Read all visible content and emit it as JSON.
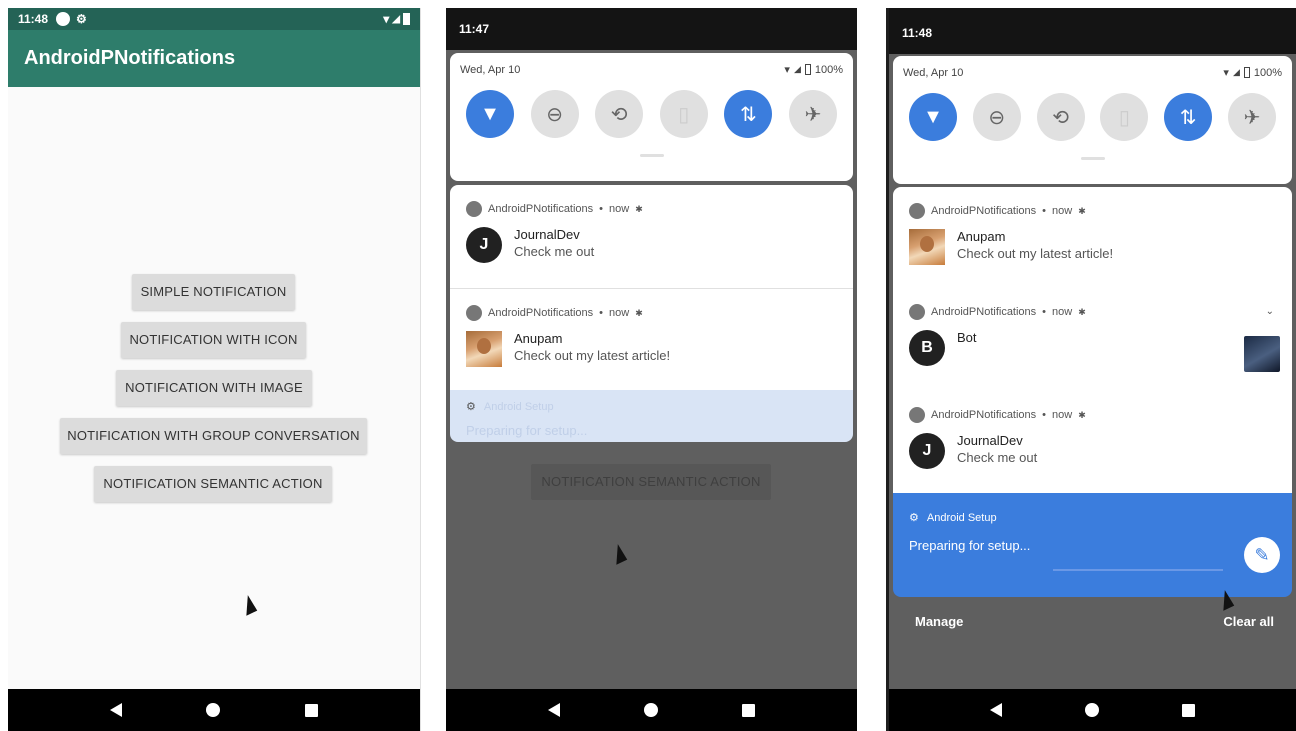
{
  "screen1": {
    "status": {
      "time": "11:48",
      "icons": [
        "circle-icon",
        "gear-icon"
      ],
      "right_icons": [
        "wifi-icon",
        "signal-icon",
        "battery-icon"
      ]
    },
    "app_title": "AndroidPNotifications",
    "buttons": [
      "SIMPLE NOTIFICATION",
      "NOTIFICATION WITH ICON",
      "NOTIFICATION WITH IMAGE",
      "NOTIFICATION WITH GROUP CONVERSATION",
      "NOTIFICATION SEMANTIC ACTION"
    ]
  },
  "screen2": {
    "time": "11:47",
    "date": "Wed, Apr 10",
    "battery": "100%",
    "tiles": [
      "wifi-icon",
      "do-not-disturb-icon",
      "auto-rotate-icon",
      "battery-saver-icon",
      "mobile-data-icon",
      "airplane-icon"
    ],
    "notifications": [
      {
        "app": "AndroidPNotifications",
        "when": "now",
        "title": "JournalDev",
        "message": "Check me out",
        "avatar": "J"
      },
      {
        "app": "AndroidPNotifications",
        "when": "now",
        "title": "Anupam",
        "message": "Check out my latest article!"
      }
    ],
    "setup_app": "Android Setup",
    "setup_message": "Preparing for setup...",
    "background_button": "NOTIFICATION SEMANTIC ACTION"
  },
  "screen3": {
    "time": "11:48",
    "date": "Wed, Apr 10",
    "battery": "100%",
    "notifications": [
      {
        "app": "AndroidPNotifications",
        "when": "now",
        "title": "Anupam",
        "message": "Check out my latest article!"
      },
      {
        "app": "AndroidPNotifications",
        "when": "now",
        "title": "Bot",
        "message": "",
        "avatar": "B"
      },
      {
        "app": "AndroidPNotifications",
        "when": "now",
        "title": "JournalDev",
        "message": "Check me out",
        "avatar": "J"
      }
    ],
    "setup_app": "Android Setup",
    "setup_message": "Preparing for setup...",
    "manage_label": "Manage",
    "clear_all_label": "Clear all"
  },
  "colors": {
    "primary": "#2e7d6b",
    "primary_dark": "#246356",
    "accent_blue": "#3b7ddd",
    "scrim": "#5f5f5f"
  }
}
